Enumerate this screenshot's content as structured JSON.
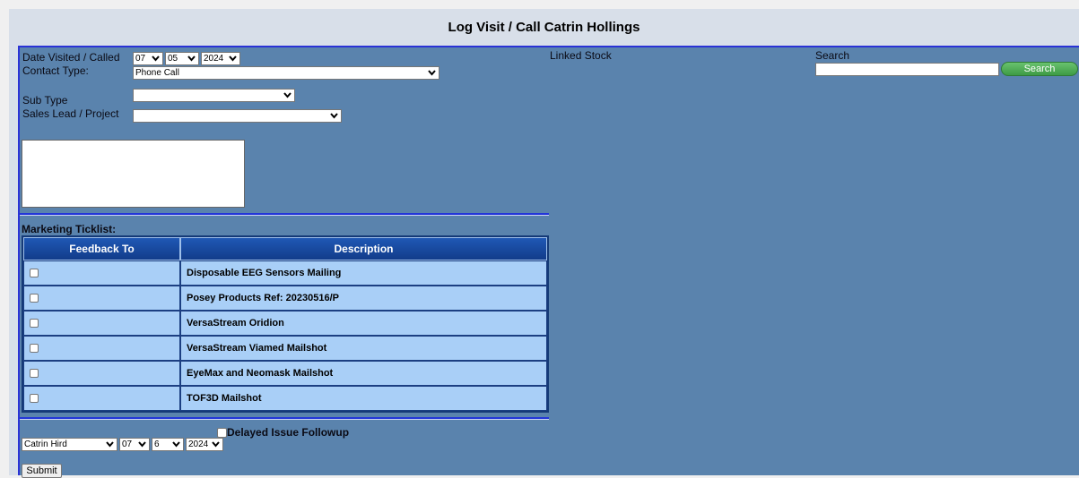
{
  "page_title": "Log Visit / Call Catrin Hollings",
  "form": {
    "date_label": "Date Visited / Called",
    "date_day": "07",
    "date_month": "05",
    "date_year": "2024",
    "contact_type_label": "Contact Type:",
    "contact_type_value": "Phone Call",
    "sub_type_label": "Sub Type",
    "sub_type_value": "",
    "sales_lead_label": "Sales Lead / Project",
    "sales_lead_value": "",
    "notes_value": ""
  },
  "linked_stock_label": "Linked Stock",
  "search": {
    "label": "Search",
    "value": "",
    "button_label": "Search"
  },
  "marketing": {
    "heading": "Marketing Ticklist:",
    "columns": [
      "Feedback To",
      "Description"
    ],
    "rows": [
      {
        "checked": false,
        "description": "Disposable EEG Sensors Mailing"
      },
      {
        "checked": false,
        "description": "Posey Products Ref: 20230516/P"
      },
      {
        "checked": false,
        "description": "VersaStream Oridion"
      },
      {
        "checked": false,
        "description": "VersaStream Viamed Mailshot"
      },
      {
        "checked": false,
        "description": "EyeMax and Neomask Mailshot"
      },
      {
        "checked": false,
        "description": "TOF3D Mailshot"
      }
    ]
  },
  "followup": {
    "label": "Delayed Issue Followup",
    "checked": false,
    "user_value": "Catrin Hird",
    "day": "07",
    "month": "6",
    "year": "2024",
    "submit_label": "Submit"
  },
  "colors": {
    "panel_bg": "#5a83ad",
    "table_header": "#153a77",
    "table_row": "#a9cff7",
    "search_button": "#4aa852"
  }
}
